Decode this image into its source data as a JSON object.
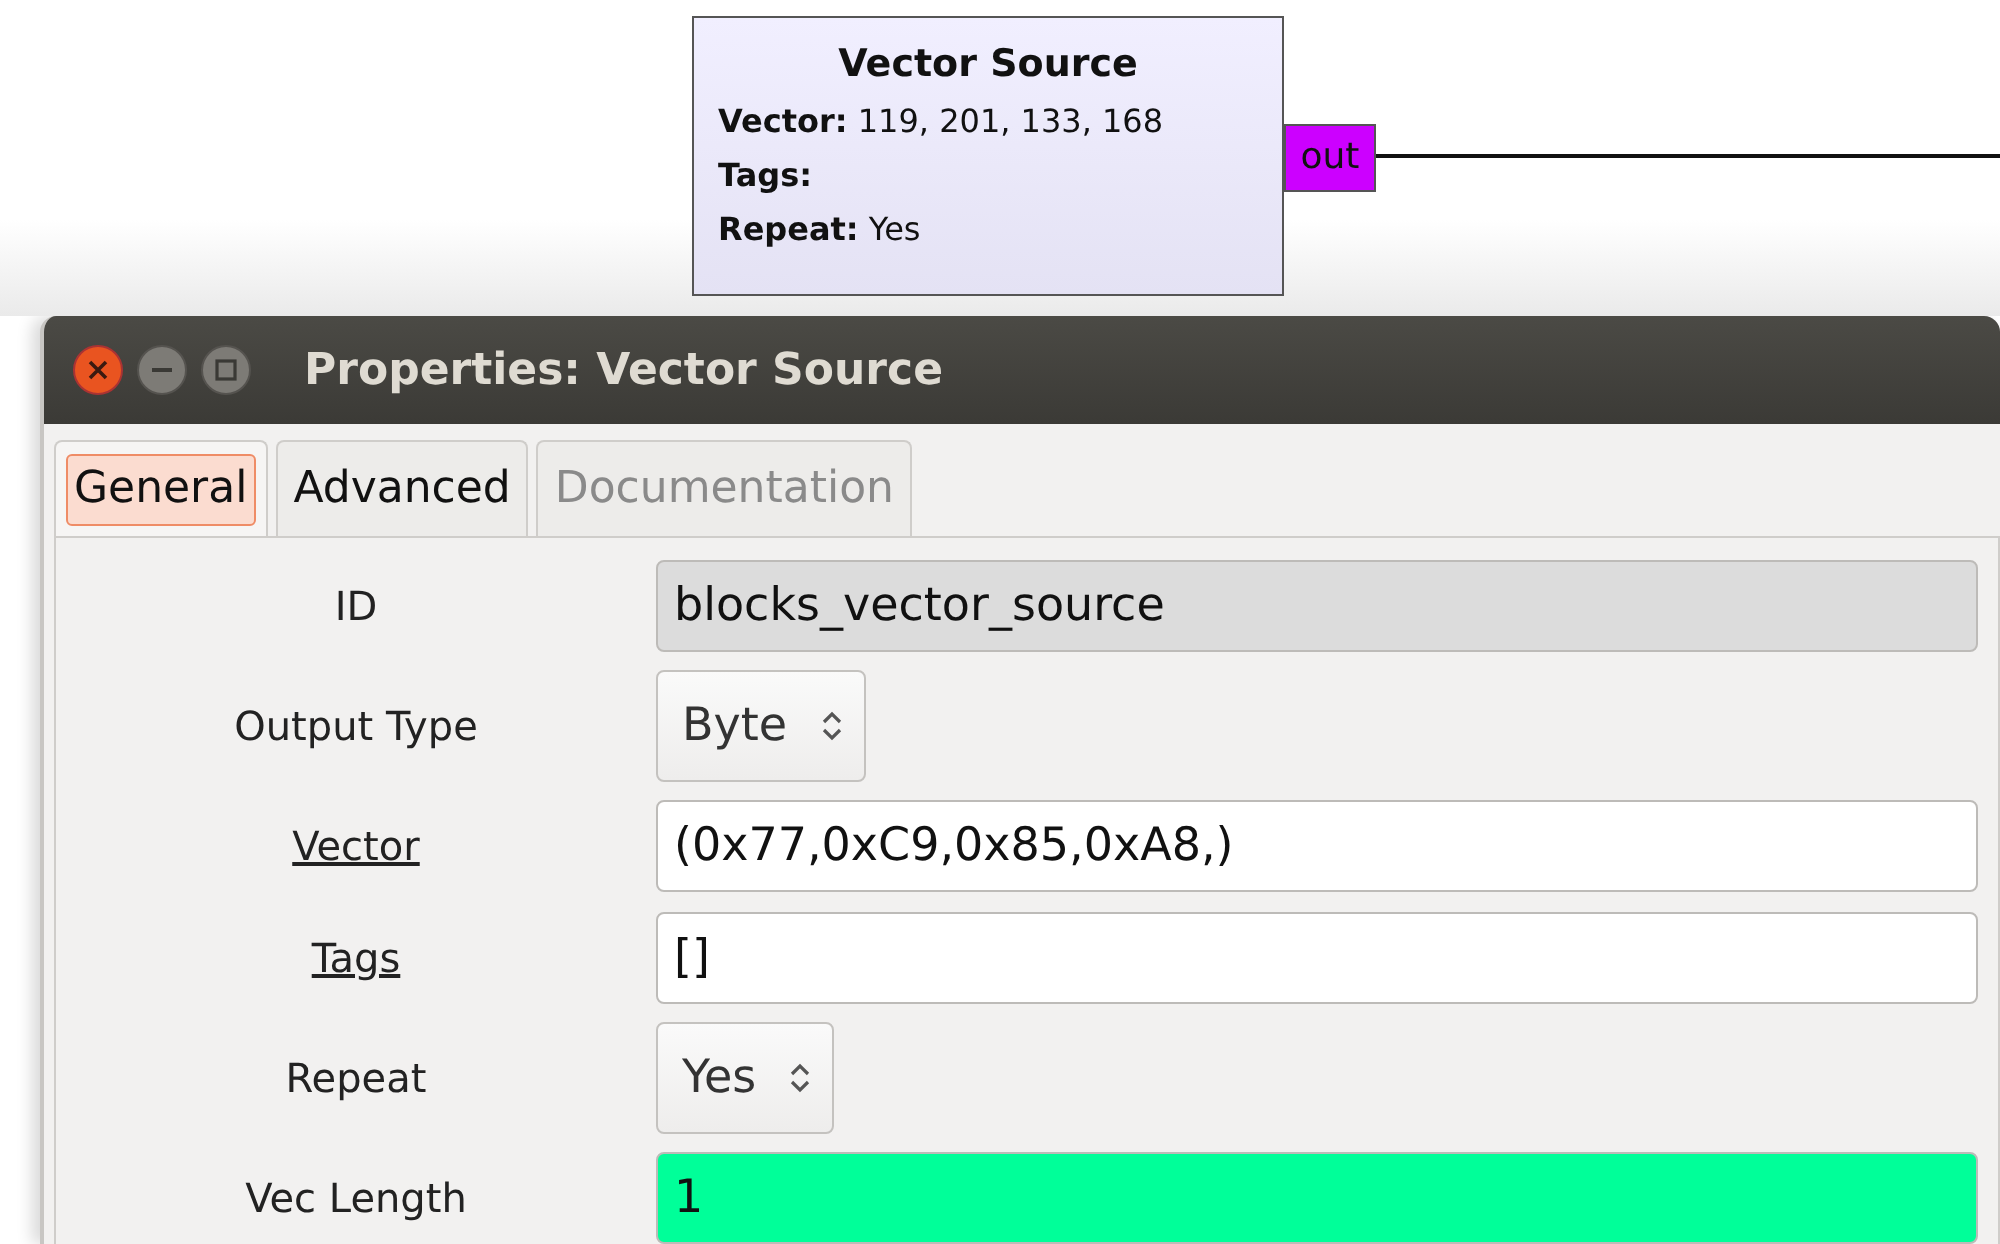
{
  "block": {
    "title": "Vector Source",
    "fields": [
      {
        "label": "Vector:",
        "value": "119, 201, 133, 168"
      },
      {
        "label": "Tags:"
      },
      {
        "label": "Repeat:",
        "value": "Yes"
      }
    ],
    "port": {
      "label": "out",
      "color": "#cc00ff"
    }
  },
  "window": {
    "title": "Properties: Vector Source"
  },
  "tabs": [
    {
      "label": "General",
      "selected": true,
      "disabled": false
    },
    {
      "label": "Advanced",
      "selected": false,
      "disabled": false
    },
    {
      "label": "Documentation",
      "selected": false,
      "disabled": true
    }
  ],
  "params": [
    {
      "label": "ID",
      "kind": "readonly",
      "value": "blocks_vector_source",
      "underlined": false
    },
    {
      "label": "Output Type",
      "kind": "combo",
      "value": "Byte",
      "underlined": false
    },
    {
      "label": "Vector",
      "kind": "entry",
      "value": "(0x77,0xC9,0x85,0xA8,)",
      "underlined": true,
      "color": "#ffffff"
    },
    {
      "label": "Tags",
      "kind": "entry",
      "value": "[]",
      "underlined": true,
      "color": "#ffffff"
    },
    {
      "label": "Repeat",
      "kind": "combo",
      "value": "Yes",
      "underlined": false
    },
    {
      "label": "Vec Length",
      "kind": "entry",
      "value": "1",
      "underlined": false,
      "color": "#00ff99"
    }
  ]
}
